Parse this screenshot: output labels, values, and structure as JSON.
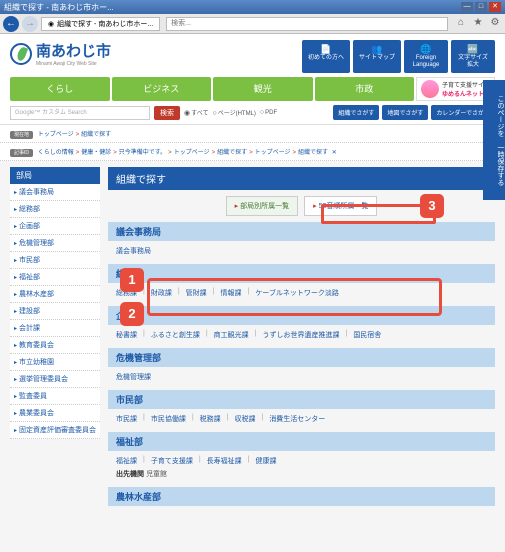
{
  "window": {
    "title": "組織で探す - 南あわじ市ホー..."
  },
  "toolbar": {
    "tab_title": "組織で探す - 南あわじ市ホー...",
    "search_placeholder": "検索..."
  },
  "logo": {
    "name": "南あわじ市",
    "sub": "Minami Awaji City Web Site"
  },
  "header_buttons": [
    {
      "icon": "📄",
      "label": "初めての方へ"
    },
    {
      "icon": "👥",
      "label": "サイトマップ"
    },
    {
      "icon": "🌐",
      "label": "Foreign\nLanguage"
    },
    {
      "icon": "🔤",
      "label": "文字サイズ\n拡大"
    }
  ],
  "nav": [
    "くらし",
    "ビジネス",
    "観光",
    "市政"
  ],
  "kosodate": {
    "line1": "子育て支援サイト",
    "line2": "ゆめるんネット"
  },
  "search": {
    "placeholder": "Google™ カスタム Search",
    "button": "検索",
    "radios": [
      {
        "label": "すべて",
        "on": true
      },
      {
        "label": "ページ(HTML)",
        "on": false
      },
      {
        "label": "PDF",
        "on": false
      }
    ]
  },
  "side_buttons": [
    "組織でさがす",
    "地図でさがす",
    "カレンダーでさがす"
  ],
  "breadcrumb1": {
    "tag": "現在地",
    "items": [
      "トップページ",
      "組織で探す"
    ]
  },
  "breadcrumb2": {
    "tag": "記事ID",
    "items": [
      "くらしの情報",
      "健康・健診",
      "只今準備中です。",
      "トップページ",
      "組織で探す",
      "トップページ",
      "組織で探す"
    ],
    "close": "✕"
  },
  "sidebar": {
    "title": "部局",
    "items": [
      "議会事務局",
      "総務部",
      "企画部",
      "危機管理部",
      "市民部",
      "福祉部",
      "農林水産部",
      "建設部",
      "会計課",
      "教育委員会",
      "市立幼稚園",
      "選挙管理委員会",
      "監査委員",
      "農業委員会",
      "固定資産評価審査委員会"
    ]
  },
  "main": {
    "title": "組織で探す",
    "filters": [
      {
        "label": "部局別所属一覧",
        "active": true
      },
      {
        "label": "50音順所属一覧",
        "active": false
      }
    ],
    "sections": [
      {
        "head": "議会事務局",
        "links": [
          "議会事務局"
        ]
      },
      {
        "head": "総務部",
        "links": [
          "総務課",
          "財政課",
          "管財課",
          "情報課",
          "ケーブルネットワーク淡路"
        ]
      },
      {
        "head": "企画部",
        "links": [
          "秘書課",
          "ふるさと創生課",
          "商工観光課",
          "うずしお世界遺産推進課",
          "国民宿舎"
        ]
      },
      {
        "head": "危機管理部",
        "links": [
          "危機管理課"
        ]
      },
      {
        "head": "市民部",
        "links": [
          "市民課",
          "市民協働課",
          "税務課",
          "収税課",
          "消費生活センター"
        ]
      },
      {
        "head": "福祉部",
        "links": [
          "福祉課",
          "子育て支援課",
          "長寿福祉課",
          "健康課"
        ],
        "sublead": "出先機関",
        "sub": "児童館"
      },
      {
        "head": "農林水産部",
        "links": []
      }
    ]
  },
  "fixed_side": "このページを　一時保存する",
  "badges": {
    "b1": "1",
    "b2": "2",
    "b3": "3"
  }
}
